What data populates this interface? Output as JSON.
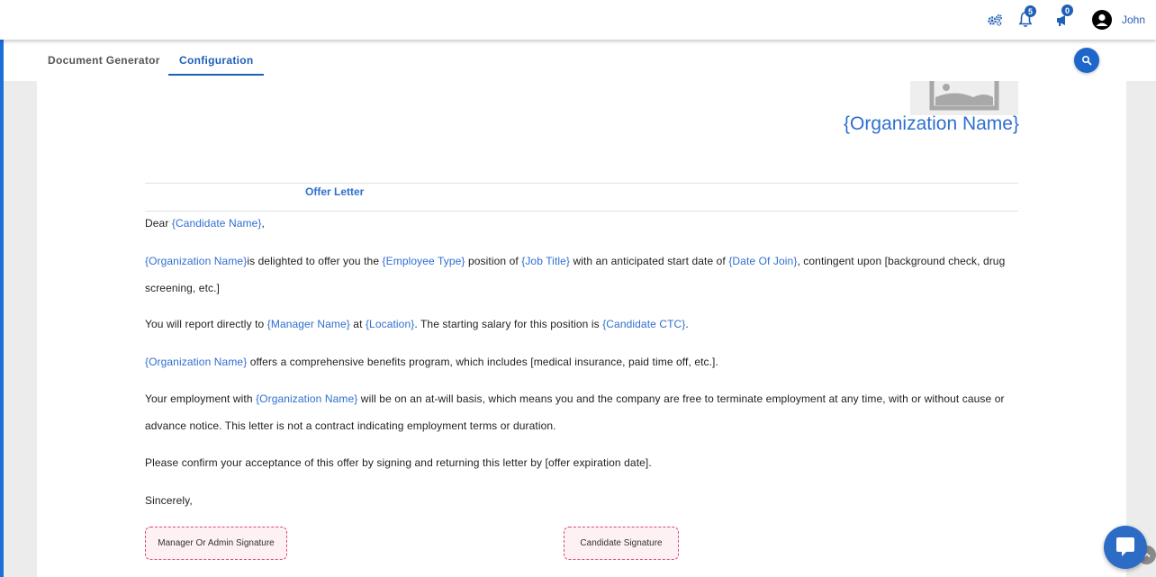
{
  "topbar": {
    "notifications_count": "5",
    "announcements_count": "0",
    "user_name": "John"
  },
  "tabs": [
    {
      "label": "Document Generator",
      "active": false
    },
    {
      "label": "Configuration",
      "active": true
    }
  ],
  "colors": {
    "accent": "#1e5fb8",
    "placeholder_text": "#2f6fd0",
    "signature_border": "#e0457a"
  },
  "document": {
    "org_title": "{Organization Name}",
    "offer_title": "Offer Letter",
    "greeting": {
      "prefix": "Dear ",
      "candidate": "{Candidate Name}",
      "suffix": ","
    },
    "p1": {
      "org": "{Organization Name}",
      "t1": "is delighted to offer you the ",
      "employee_type": "{Employee Type}",
      "t2": " position of ",
      "job_title": "{Job Title}",
      "t3": " with an anticipated start date of ",
      "date_of_join": "{Date Of Join}",
      "t4": ", contingent upon [background check, drug screening, etc.]"
    },
    "p2": {
      "t1": "You will report directly to ",
      "manager": "{Manager Name}",
      "t2": " at ",
      "location": "{Location}",
      "t3": ". The starting salary for this position is ",
      "ctc": "{Candidate CTC}",
      "t4": "."
    },
    "p3": {
      "org": "{Organization Name}",
      "t1": " offers a comprehensive benefits program, which includes [medical insurance, paid time off, etc.]."
    },
    "p4": {
      "t1": "Your employment with ",
      "org": "{Organization Name}",
      "t2": " will be on an at-will basis, which means you and the company are free to terminate employment at any time, with or without cause or advance notice. This letter is not a contract indicating employment terms or duration."
    },
    "p5": "Please confirm your acceptance of this offer by signing and returning this letter by [offer expiration date].",
    "closing": "Sincerely,",
    "signatures": {
      "manager": "Manager Or Admin Signature",
      "candidate": "Candidate Signature"
    }
  },
  "icons": {
    "settings": "gears-icon",
    "notifications": "bell-icon",
    "announcements": "megaphone-icon",
    "user": "user-avatar-icon",
    "search": "search-icon",
    "logo": "image-placeholder-icon",
    "chat": "chat-icon",
    "scroll_top": "chevron-up-icon"
  }
}
